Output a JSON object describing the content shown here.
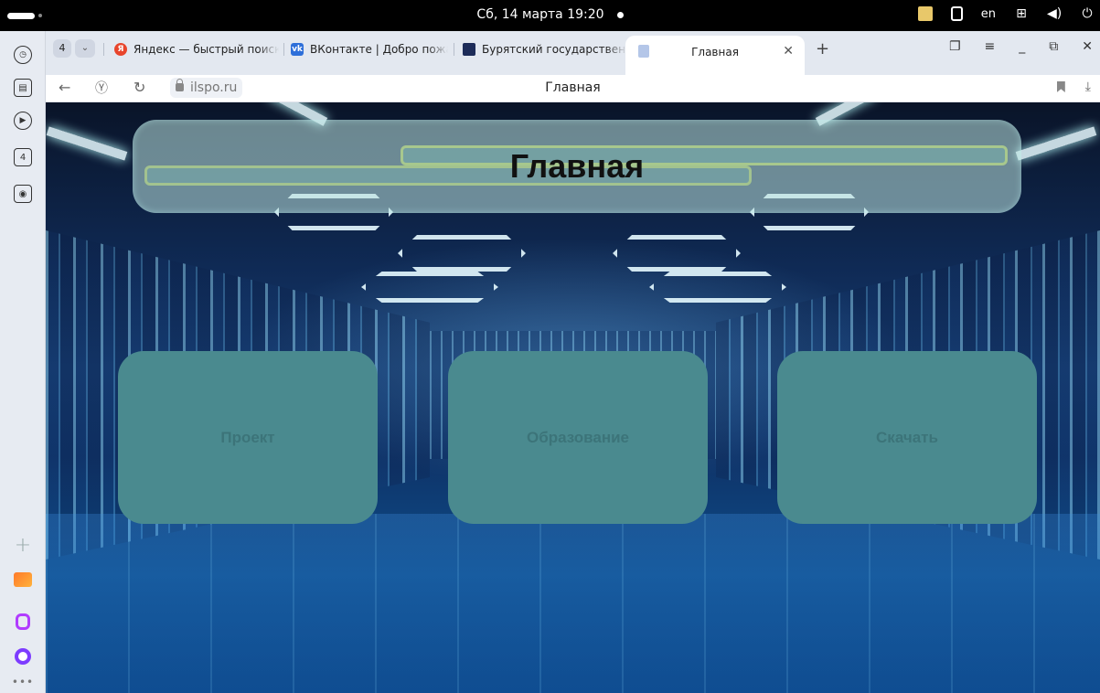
{
  "os": {
    "clock": "Сб, 14 марта 19:20",
    "lang": "en"
  },
  "tabs": {
    "count": "4",
    "items": [
      {
        "label": "Яндекс — быстрый поиск",
        "icon": "yandex-icon",
        "color": "#e8452c"
      },
      {
        "label": "ВКонтакте | Добро пожаловать",
        "icon": "vk-icon",
        "color": "#2e6fd9"
      },
      {
        "label": "Бурятский государственный",
        "icon": "site-icon",
        "color": "#1d2c59"
      }
    ],
    "active": {
      "label": "Главная"
    }
  },
  "address": {
    "url": "ilspo.ru",
    "page_title": "Главная"
  },
  "page": {
    "header_title": "Главная",
    "cards": [
      {
        "label": "Проект"
      },
      {
        "label": "Образование"
      },
      {
        "label": "Скачать"
      }
    ]
  }
}
